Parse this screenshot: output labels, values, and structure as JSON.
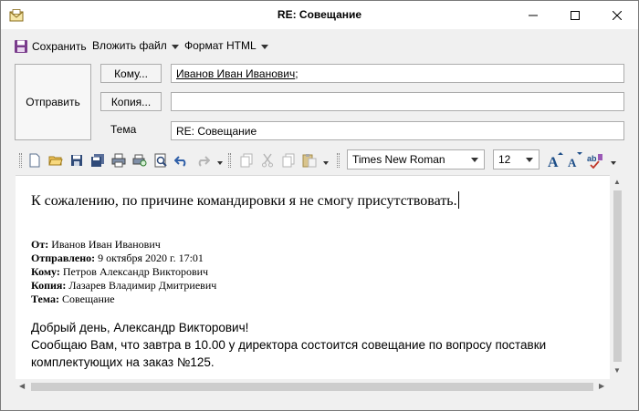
{
  "window": {
    "title": "RE: Совещание"
  },
  "menu": {
    "save": "Сохранить",
    "attach": "Вложить файл",
    "format": "Формат HTML"
  },
  "header": {
    "send": "Отправить",
    "to_button": "Кому...",
    "cc_button": "Копия...",
    "subject_label": "Тема",
    "to_value": "Иванов Иван Иванович",
    "to_separator": ";",
    "cc_value": "",
    "subject_value": "RE: Совещание"
  },
  "format": {
    "font": "Times New Roman",
    "size": "12"
  },
  "body": {
    "reply": "К сожалению, по причине командировки я не смогу присутствовать.",
    "quote": {
      "from_label": "От:",
      "from": "Иванов Иван Иванович",
      "sent_label": "Отправлено:",
      "sent": "9 октября 2020 г. 17:01",
      "to_label": "Кому:",
      "to": "Петров Александр Викторович",
      "cc_label": "Копия:",
      "cc": "Лазарев Владимир Дмитриевич",
      "subject_label": "Тема:",
      "subject": "Совещание"
    },
    "greeting": "Добрый день, Александр Викторович!",
    "message": "Сообщаю Вам, что завтра в 10.00 у директора состоится совещание по вопросу поставки комплектующих на заказ №125."
  },
  "colors": {
    "accent": "#1c4d87",
    "save_icon": "#7a3c8c"
  },
  "icons": [
    "email-app-icon",
    "minimize-icon",
    "maximize-icon",
    "close-icon",
    "save-icon",
    "new-document-icon",
    "open-folder-icon",
    "save-disk-icon",
    "save-all-icon",
    "print-icon",
    "print-preview-icon",
    "preview-icon",
    "undo-icon",
    "redo-icon",
    "copy-icon",
    "cut-icon",
    "paste-icon",
    "paste-special-icon",
    "grow-font-icon",
    "shrink-font-icon",
    "spellcheck-icon"
  ]
}
